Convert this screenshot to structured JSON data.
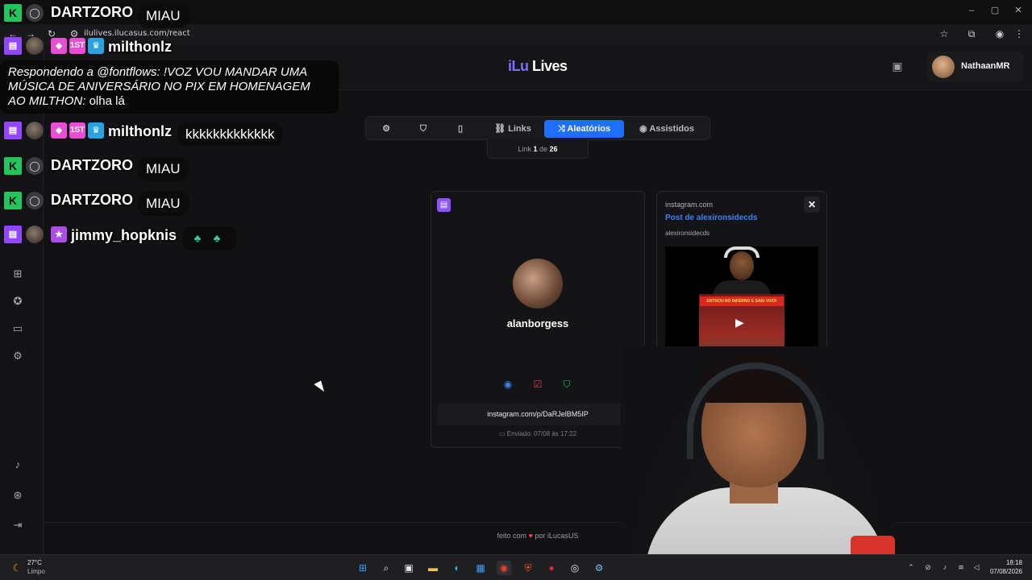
{
  "browser": {
    "url": "ilulives.ilucasus.com/react"
  },
  "app": {
    "logo_part1": "iLu",
    "logo_part2": "Lives",
    "user_name": "NathaanMR"
  },
  "tabs": [
    {
      "label": "",
      "icon": "gear-icon"
    },
    {
      "label": "",
      "icon": "shield-icon"
    },
    {
      "label": "",
      "icon": "tablet-icon"
    },
    {
      "label": "Links",
      "icon": "link-icon"
    },
    {
      "label": "Aleatórios",
      "icon": "shuffle-icon",
      "active": true
    },
    {
      "label": "Assistidos",
      "icon": "eye-icon"
    }
  ],
  "link_counter": {
    "prefix": "Link",
    "current": "1",
    "separator": "de",
    "total": "26"
  },
  "card": {
    "username": "alanborgess",
    "link": "instagram.com/p/DaRJelBM5IP",
    "sent": "Enviado: 07/08 às 17:22"
  },
  "preview": {
    "domain": "instagram.com",
    "title": "Post de alexironsidecds",
    "user": "alexironsidecds",
    "video_banner": "ENTROU NO INFERNO E SAIU VIVO!"
  },
  "footer": {
    "before": "feito com",
    "heart": "♥",
    "after": "por iLucasUS"
  },
  "chat": {
    "messages": [
      {
        "name": "DARTZORO",
        "text": "MIAU"
      },
      {
        "name": "milthonlz",
        "text": ""
      },
      {
        "name": "milthonlz",
        "text": "kkkkkkkkkkkkk"
      },
      {
        "name": "DARTZORO",
        "text": "MIAU"
      },
      {
        "name": "DARTZORO",
        "text": "MIAU"
      },
      {
        "name": "jimmy_hopknis",
        "text": ""
      }
    ],
    "reply_prefix": "Respondendo a @fontflows: !VOZ VOU MANDAR UMA MÚSICA DE ANIVERSÁRIO NO PIX EM HOMENAGEM AO MILTHON:",
    "reply_text": "olha lá",
    "badge_first": "1ST"
  },
  "taskbar": {
    "temp": "27°C",
    "weather": "Limpo",
    "time": "18:18",
    "date": "07/08/2026"
  },
  "colors": {
    "accent": "#1d6fff",
    "logo_accent": "#7c6cff",
    "kick": "#22c55e",
    "twitch": "#9146ff"
  }
}
